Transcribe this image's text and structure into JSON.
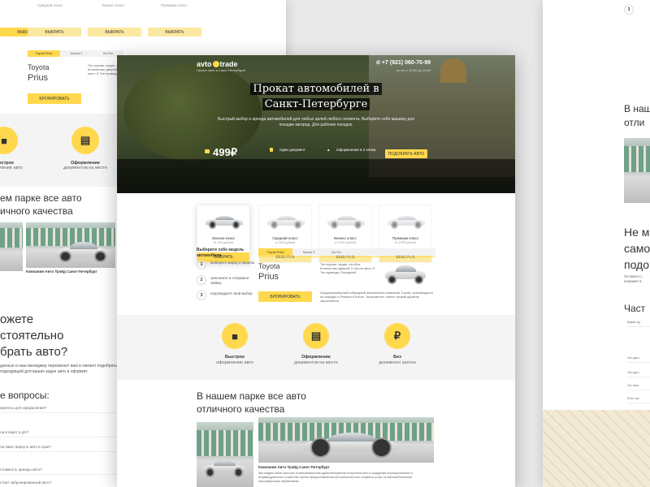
{
  "brand": {
    "logo_left": "avto",
    "logo_right": "trade",
    "tagline": "Прокат авто в Санкт-Петербурге",
    "phone": "+7 (921) 060-70-99",
    "phone_sub": "вс-пн: с 10:00 до 19:00"
  },
  "hero": {
    "title_line1": "Прокат автомобилей в",
    "title_line2": "Санкт-Петербурге",
    "subtitle": "Быстрый выбор и аренда автомобилей для любых целей любого сегмента. Выберите себе машину для поездки загород. Для рабочих поездок.",
    "price": "499₽",
    "stat1": "Один документ",
    "stat2": "Оформление в 2 клика",
    "cta": "ПОДОБРАТЬ АВТО"
  },
  "cards": [
    {
      "name": "Эконом класс",
      "price": "от 499 рублей",
      "button": "ВЫБРАТЬ"
    },
    {
      "name": "Средний класс",
      "price": "от 899 рублей",
      "button": "ВЫБРАТЬ"
    },
    {
      "name": "Бизнес класс",
      "price": "от 1499 рублей",
      "button": "ВЫБРАТЬ"
    },
    {
      "name": "Премиум класс",
      "price": "от 1999 рублей",
      "button": "ВЫБРАТЬ"
    }
  ],
  "steps": {
    "title": "Выберите себе модель автомобиля",
    "items": [
      {
        "num": "1",
        "text": "выберите марку и модель"
      },
      {
        "num": "2",
        "text": "заполните и отправьте заявку"
      },
      {
        "num": "3",
        "text": "подтвердите свой выбор"
      }
    ]
  },
  "tabs": [
    "Toyota Prius",
    "Mazda 3",
    "Kia Rio"
  ],
  "model": {
    "brand": "Toyota",
    "name": "Prius",
    "specs": "Тип кузова: седан, хэтчбек Количество дверей: 5 Число мест: 5 Тип привода: Передний",
    "button": "БРОНИРОВАТЬ",
    "description": "Среднеразмерный гибридный автомобиль компании Toyota, производится на заводах в Японии и Китае. Экономичен, имеет низкий уровень загрязнения."
  },
  "features": [
    {
      "title": "Быстрое",
      "sub": "оформление авто",
      "icon": "car-icon"
    },
    {
      "title": "Оформление",
      "sub": "документов на месте",
      "icon": "document-icon"
    },
    {
      "title": "Без",
      "sub": "денежного залога",
      "icon": "ruble-icon"
    }
  ],
  "fleet": {
    "title_line1": "В нашем парке все авто",
    "title_line2": "отличного качества",
    "company": "Компания Авто Трэйд Санкт-Петербург",
    "text": "Мы видим свою миссию в максимальном удовлетворении потребностей и ожиданий корпоративных и индивидуальных клиентов путем предоставления им комплексного сервиса услуг по автомобильным пассажирским перевозкам."
  },
  "left": {
    "line1": "ем парке все авто",
    "line2": "ичного качества",
    "company": "Компания Авто Трэйд Санкт-Петербург",
    "form_line1": "ожете",
    "form_line2": "стоятельно",
    "form_line3": "брать авто?",
    "form_text": "данные и наш менеджер перезвонит вам и оможет подобрать подходящий для ваших задач авто и оформит.",
    "questions_title": "е вопросы:",
    "questions": [
      "кументы для оформления?",
      "ли в пакет в д/п?",
      "ли пакет вернуть авто в срок?",
      "стоимость аренды авто?",
      "стоит забронированный авто?"
    ]
  },
  "right": {
    "title1a": "В наш",
    "title1b": "отли",
    "title2a": "Не м",
    "title2b": "само",
    "title2c": "подо",
    "title2d": "Оставьте с",
    "title2e": "поможет в",
    "title3": "Част",
    "questions": [
      "Какие ну",
      "Что дол",
      "Что дел",
      "Что вхо",
      "Есть ли"
    ]
  }
}
